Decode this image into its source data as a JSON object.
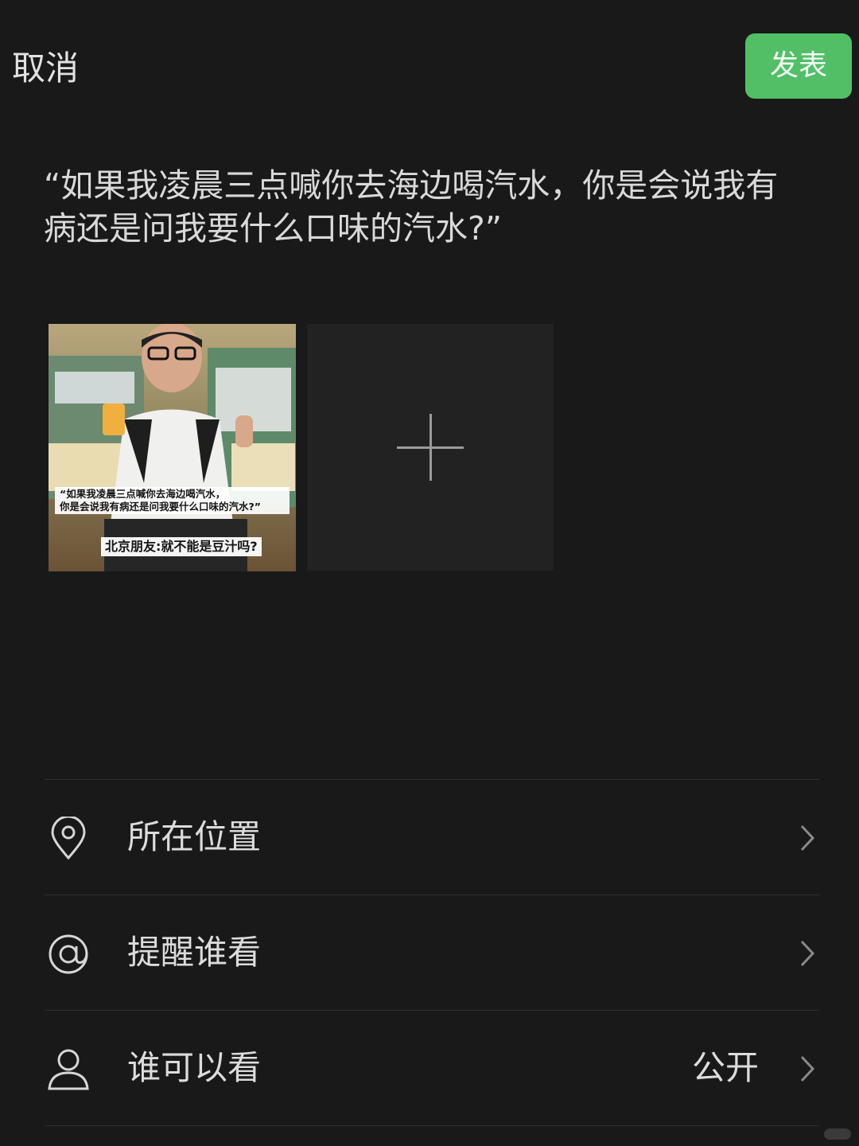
{
  "header": {
    "cancel_label": "取消",
    "publish_label": "发表",
    "accent_color": "#52bf67"
  },
  "post": {
    "text": "“如果我凌晨三点喊你去海边喝汽水，你是会说我有病还是问我要什么口味的汽水?”"
  },
  "media": {
    "photo_caption_line1": "“如果我凌晨三点喊你去海边喝汽水，",
    "photo_caption_line2": "你是会说我有病还是问我要什么口味的汽水?”",
    "photo_caption_reply": "北京朋友:就不能是豆汁吗?",
    "add_icon": "plus-icon"
  },
  "options": [
    {
      "icon": "location-pin-icon",
      "label": "所在位置",
      "value": ""
    },
    {
      "icon": "at-sign-icon",
      "label": "提醒谁看",
      "value": ""
    },
    {
      "icon": "person-icon",
      "label": "谁可以看",
      "value": "公开"
    }
  ]
}
